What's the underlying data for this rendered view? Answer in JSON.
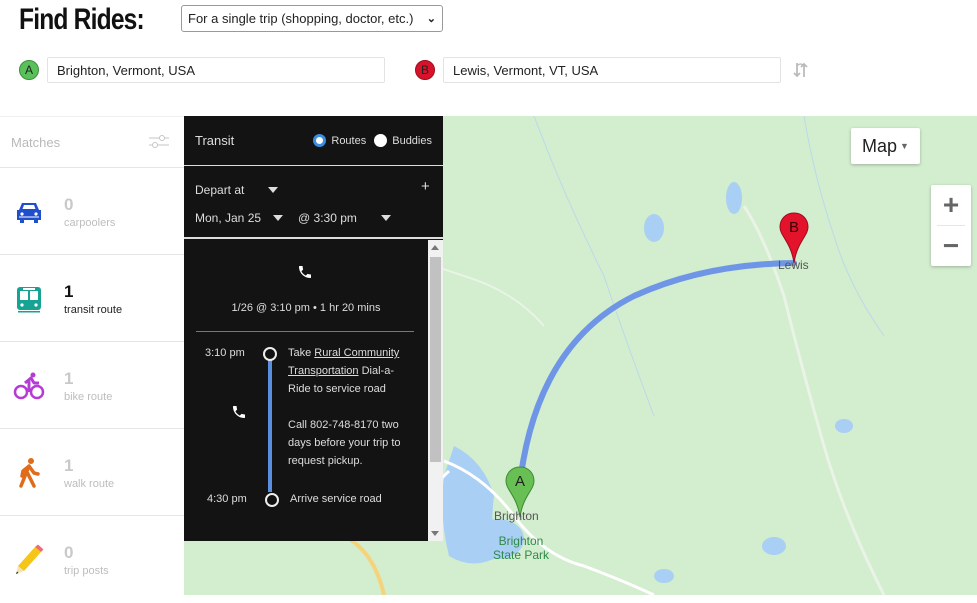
{
  "header": {
    "title": "Find Rides:",
    "trip_type": "For a single trip  (shopping, doctor, etc.)",
    "origin_marker": "A",
    "origin_value": "Brighton, Vermont, USA",
    "destination_marker": "B",
    "destination_value": "Lewis, Vermont, VT, USA"
  },
  "sidebar": {
    "heading": "Matches",
    "items": [
      {
        "count": "0",
        "label": "carpoolers",
        "icon": "car-icon",
        "color": "#1f4fcc"
      },
      {
        "count": "1",
        "label": "transit route",
        "icon": "train-icon",
        "color": "#16a394"
      },
      {
        "count": "1",
        "label": "bike route",
        "icon": "bike-icon",
        "color": "#b53ad6"
      },
      {
        "count": "1",
        "label": "walk route",
        "icon": "walk-icon",
        "color": "#e06b1b"
      },
      {
        "count": "0",
        "label": "trip posts",
        "icon": "pencil-icon",
        "color": "#f5c518"
      }
    ]
  },
  "panel": {
    "title": "Transit",
    "radio_routes": "Routes",
    "radio_buddies": "Buddies",
    "selected_radio": "Routes",
    "depart_mode": "Depart at",
    "date": "Mon, Jan 25",
    "time": "@ 3:30 pm",
    "summary": "1/26 @ 3:10 pm  •  1 hr 20 mins",
    "steps": [
      {
        "time": "3:10 pm",
        "text_prefix": "Take ",
        "link": "Rural Community Transportation",
        "text_suffix": " Dial-a-Ride to service road",
        "note": "Call 802-748-8170 two days before your trip to request pickup."
      },
      {
        "time": "4:30 pm",
        "text": "Arrive service road"
      }
    ]
  },
  "map": {
    "type_button": "Map",
    "zoom_in": "+",
    "zoom_out": "−",
    "labels": {
      "brighton": "Brighton",
      "park": "Brighton State Park",
      "lewis": "Lewis"
    },
    "marker_a": "A",
    "marker_b": "B",
    "route_color": "#6f96e6"
  }
}
